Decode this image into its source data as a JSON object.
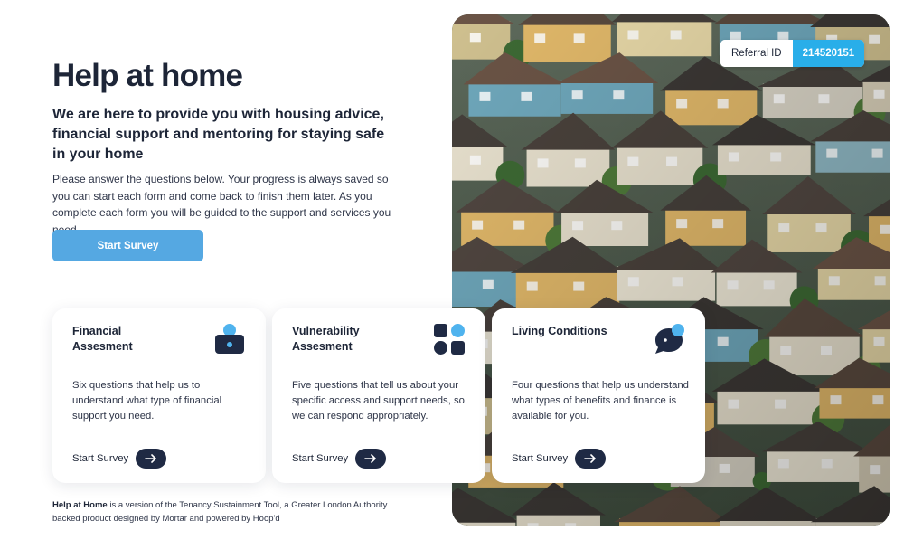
{
  "hero": {
    "title": "Help at home",
    "subtitle": "We are here to provide you with housing advice, financial support and mentoring for staying safe in your home",
    "intro": "Please answer the questions below. Your progress is always saved so you can start each form and come back to finish them later. As you complete each form you will be guided to the support and services you need.",
    "start_label": "Start Survey"
  },
  "referral": {
    "label": "Referral ID",
    "value": "214520151"
  },
  "cards": [
    {
      "title": "Financial Assesment",
      "icon": "wallet-icon",
      "description": "Six questions that help us to understand what type of financial support you need.",
      "link_label": "Start Survey"
    },
    {
      "title": "Vulnerability Assesment",
      "icon": "grid-icon",
      "description": "Five questions that tell us about your specific access and support needs, so we can respond appropriately.",
      "link_label": "Start Survey"
    },
    {
      "title": "Living Conditions",
      "icon": "chat-bubble-icon",
      "description": "Four questions that help us understand what types of benefits and finance is available for you.",
      "link_label": "Start Survey"
    }
  ],
  "footer": {
    "brand": "Help at Home",
    "text": " is a version of the Tenancy Sustainment Tool, a Greater London Authority backed product designed by Mortar and powered by Hoop'd"
  },
  "colors": {
    "text": "#1d2537",
    "button": "#55a8e2",
    "accent": "#29aee9",
    "icon_dark": "#1f2a44",
    "icon_light": "#4fb3ee"
  }
}
